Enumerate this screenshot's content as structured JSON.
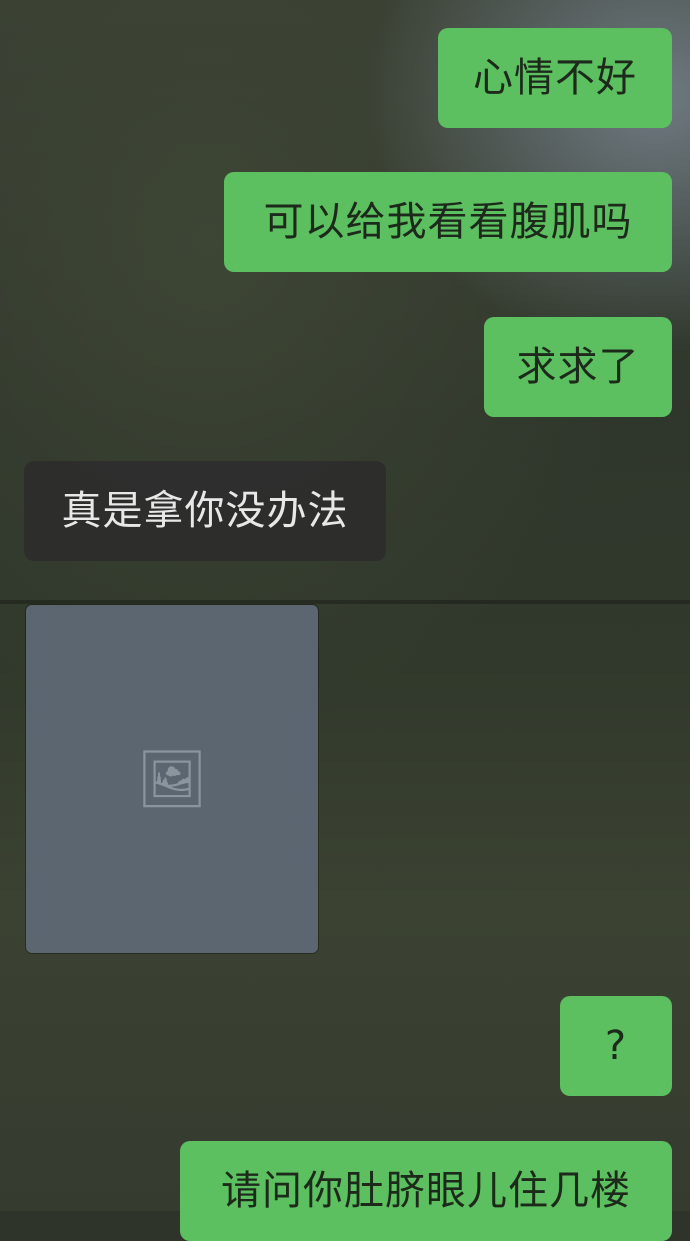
{
  "messages": [
    {
      "side": "sent",
      "text": "心情不好"
    },
    {
      "side": "sent",
      "text": "可以给我看看腹肌吗"
    },
    {
      "side": "sent",
      "text": "求求了"
    },
    {
      "side": "received",
      "text": "真是拿你没办法"
    },
    {
      "side": "received",
      "type": "image"
    },
    {
      "side": "sent",
      "text": "?"
    },
    {
      "side": "sent",
      "text": "请问你肚脐眼儿住几楼"
    }
  ],
  "colors": {
    "sent_bubble": "#5cc060",
    "received_bubble": "#2c2c2c"
  }
}
